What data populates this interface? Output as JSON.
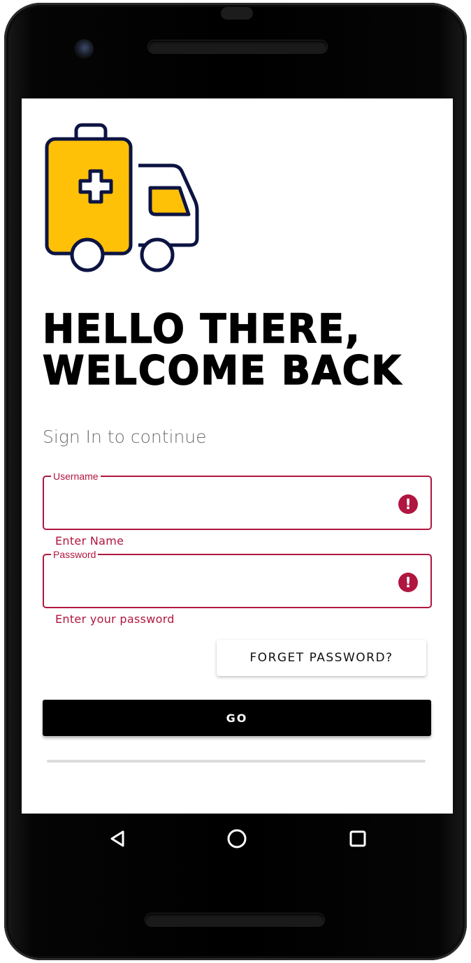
{
  "app": {
    "headline_line1": "HELLO THERE,",
    "headline_line2": "WELCOME BACK",
    "subtitle": "Sign In to continue"
  },
  "form": {
    "username": {
      "label": "Username",
      "value": "",
      "helper": "Enter Name",
      "error_icon": "!"
    },
    "password": {
      "label": "Password",
      "value": "",
      "helper": "Enter your password",
      "error_icon": "!"
    },
    "forget_label": "FORGET PASSWORD?",
    "go_label": "GO"
  },
  "icons": {
    "logo": "medical-delivery-truck-icon",
    "error": "error-exclamation-icon",
    "nav_back": "back-triangle-icon",
    "nav_home": "home-circle-icon",
    "nav_recent": "recents-square-icon"
  },
  "colors": {
    "error": "#b0163f",
    "accent_yellow": "#ffc107",
    "navy": "#0d1442",
    "button_dark": "#000000"
  }
}
